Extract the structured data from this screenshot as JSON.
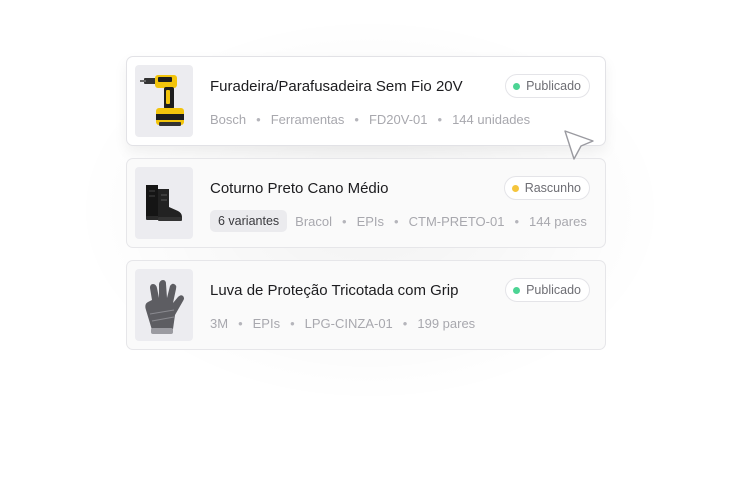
{
  "products": [
    {
      "title": "Furadeira/Parafusadeira Sem Fio 20V",
      "status": "Publicado",
      "status_color": "#4cd494",
      "brand": "Bosch",
      "category": "Ferramentas",
      "sku": "FD20V-01",
      "stock": "144 unidades",
      "image_icon": "drill-icon"
    },
    {
      "title": "Coturno Preto Cano Médio",
      "status": "Rascunho",
      "status_color": "#f5c53c",
      "variants": "6 variantes",
      "brand": "Bracol",
      "category": "EPIs",
      "sku": "CTM-PRETO-01",
      "stock": "144 pares",
      "image_icon": "boots-icon"
    },
    {
      "title": "Luva de Proteção Tricotada com Grip",
      "status": "Publicado",
      "status_color": "#4cd494",
      "brand": "3M",
      "category": "EPIs",
      "sku": "LPG-CINZA-01",
      "stock": "199 pares",
      "image_icon": "glove-icon"
    }
  ],
  "separator": "•",
  "cursor_icon": "mouse-pointer-icon"
}
